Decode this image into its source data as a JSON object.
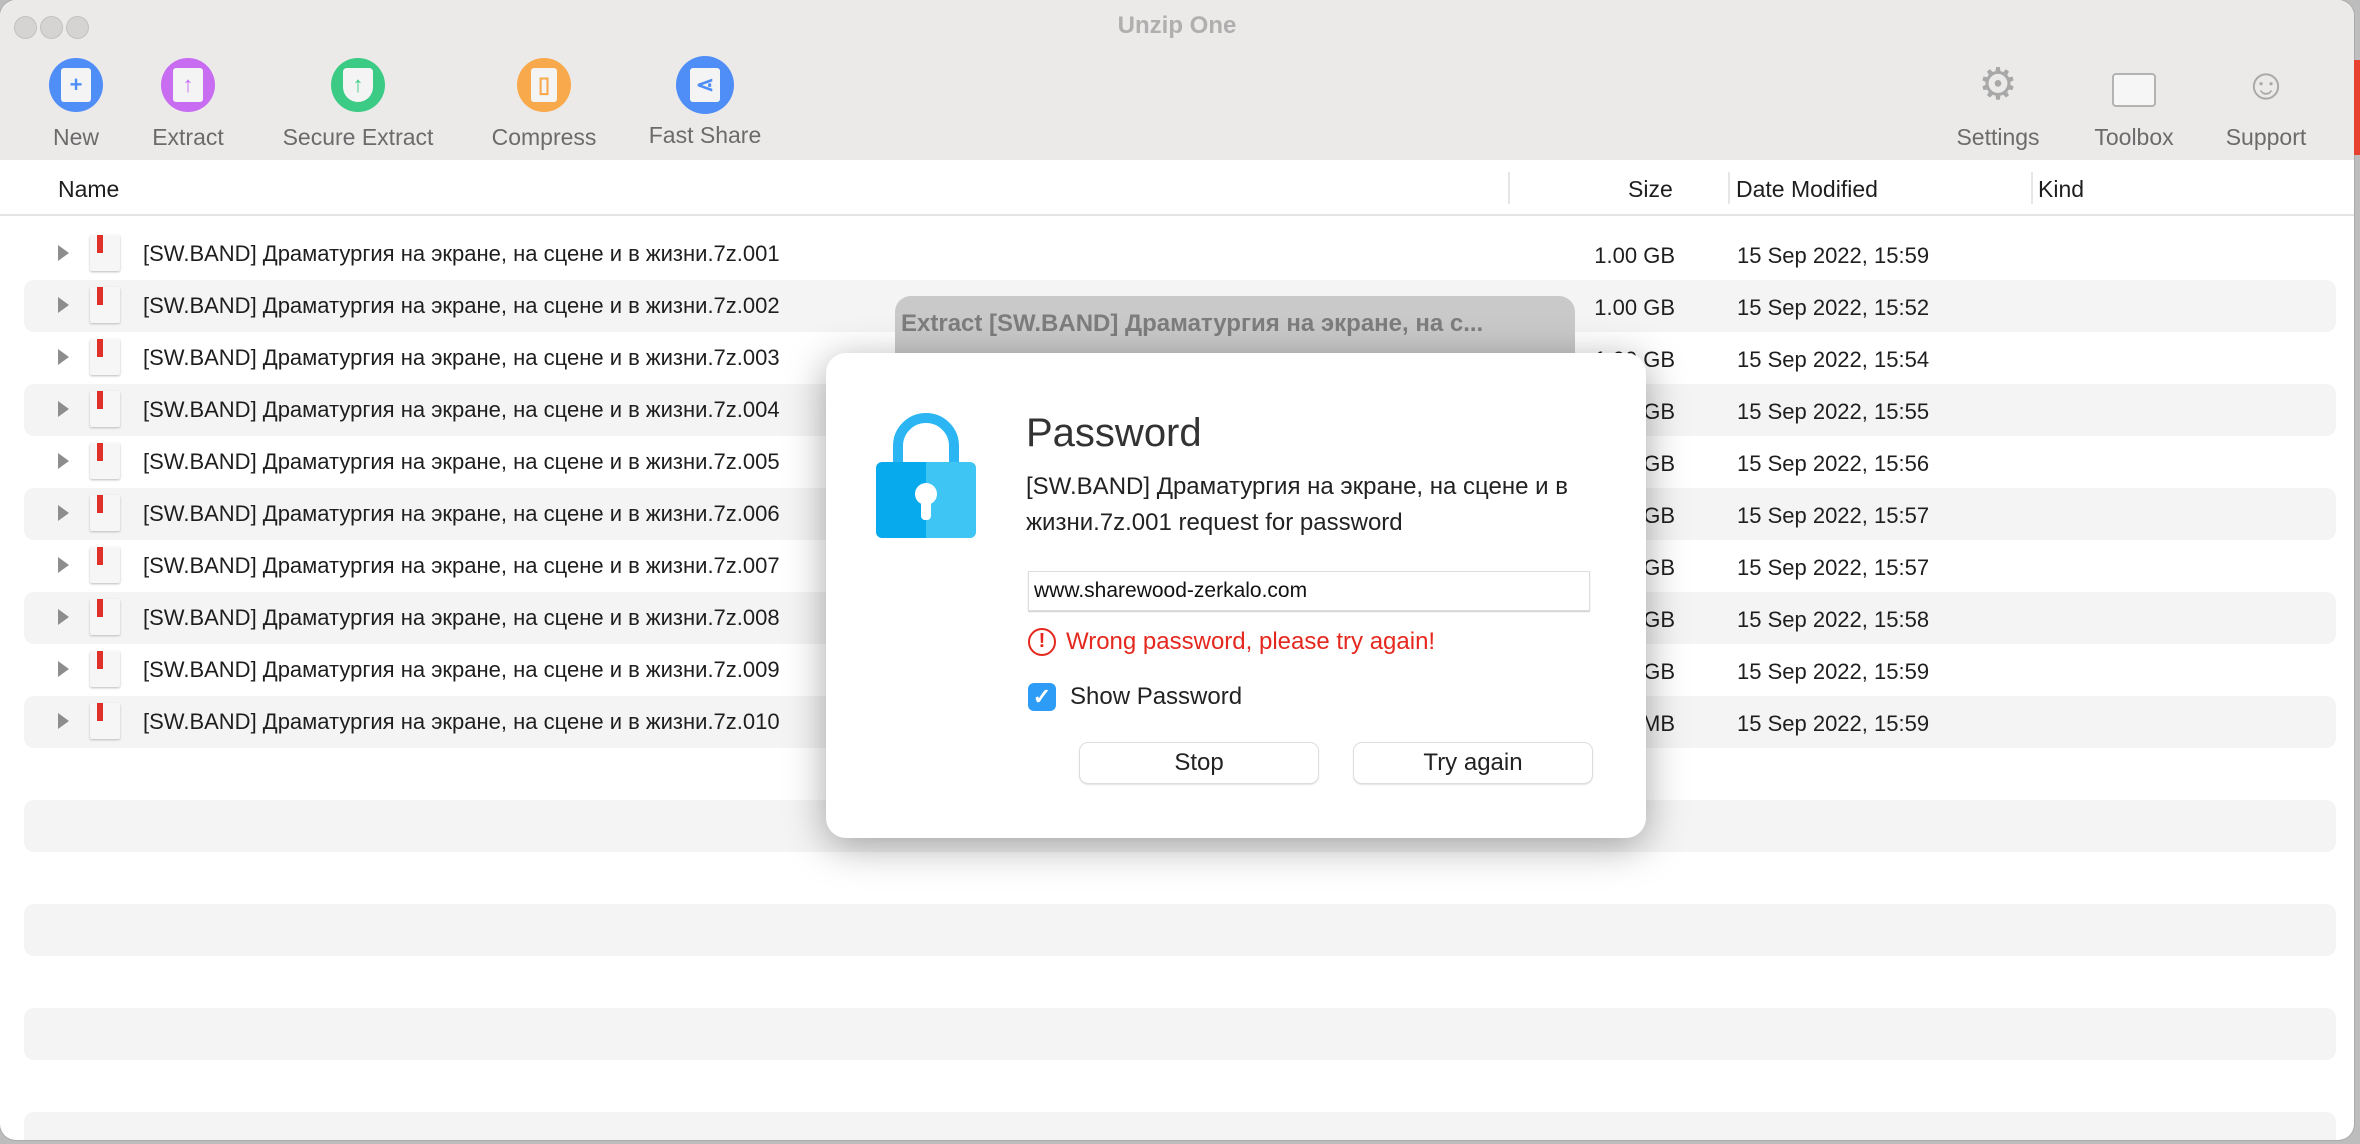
{
  "window": {
    "title": "Unzip One"
  },
  "toolbar": {
    "left": [
      {
        "label": "New",
        "icon": "new-archive-icon",
        "color": "#4f8ef7"
      },
      {
        "label": "Extract",
        "icon": "extract-icon",
        "color": "#c86cf2"
      },
      {
        "label": "Secure Extract",
        "icon": "secure-extract-shield-icon",
        "color": "#3ccb84"
      },
      {
        "label": "Compress",
        "icon": "compress-icon",
        "color": "#f8a94c"
      },
      {
        "label": "Fast Share",
        "icon": "fast-share-icon",
        "color": "#4f8ef7"
      }
    ],
    "right": [
      {
        "label": "Settings",
        "icon": "gear-icon"
      },
      {
        "label": "Toolbox",
        "icon": "toolbox-icon"
      },
      {
        "label": "Support",
        "icon": "support-headset-icon"
      }
    ]
  },
  "columns": {
    "name": "Name",
    "size": "Size",
    "date": "Date Modified",
    "kind": "Kind"
  },
  "files": [
    {
      "name": "[SW.BAND] Драматургия на экране, на сцене и в жизни.7z.001",
      "size": "1.00 GB",
      "date": "15 Sep 2022, 15:59"
    },
    {
      "name": "[SW.BAND] Драматургия на экране, на сцене и в жизни.7z.002",
      "size": "1.00 GB",
      "date": "15 Sep 2022, 15:52"
    },
    {
      "name": "[SW.BAND] Драматургия на экране, на сцене и в жизни.7z.003",
      "size": "1.00 GB",
      "date": "15 Sep 2022, 15:54"
    },
    {
      "name": "[SW.BAND] Драматургия на экране, на сцене и в жизни.7z.004",
      "size": "1.00 GB",
      "date": "15 Sep 2022, 15:55"
    },
    {
      "name": "[SW.BAND] Драматургия на экране, на сцене и в жизни.7z.005",
      "size": "1.00 GB",
      "date": "15 Sep 2022, 15:56"
    },
    {
      "name": "[SW.BAND] Драматургия на экране, на сцене и в жизни.7z.006",
      "size": "1.00 GB",
      "date": "15 Sep 2022, 15:57"
    },
    {
      "name": "[SW.BAND] Драматургия на экране, на сцене и в жизни.7z.007",
      "size": "1.00 GB",
      "date": "15 Sep 2022, 15:57"
    },
    {
      "name": "[SW.BAND] Драматургия на экране, на сцене и в жизни.7z.008",
      "size": "1.00 GB",
      "date": "15 Sep 2022, 15:58"
    },
    {
      "name": "[SW.BAND] Драматургия на экране, на сцене и в жизни.7z.009",
      "size": "1.00 GB",
      "date": "15 Sep 2022, 15:59"
    },
    {
      "name": "[SW.BAND] Драматургия на экране, на сцене и в жизни.7z.010",
      "size": "6.0 MB",
      "date": "15 Sep 2022, 15:59"
    }
  ],
  "sheet": {
    "title": "Extract [SW.BAND] Драматургия на экране, на с..."
  },
  "dialog": {
    "title": "Password",
    "message": "[SW.BAND] Драматургия на экране, на сцене и в жизни.7z.001 request for password",
    "password_value": "www.sharewood-zerkalo.com",
    "error": "Wrong password, please try again!",
    "error_color": "#e5281e",
    "show_password_label": "Show Password",
    "show_password_checked": true,
    "stop_label": "Stop",
    "try_again_label": "Try again"
  }
}
